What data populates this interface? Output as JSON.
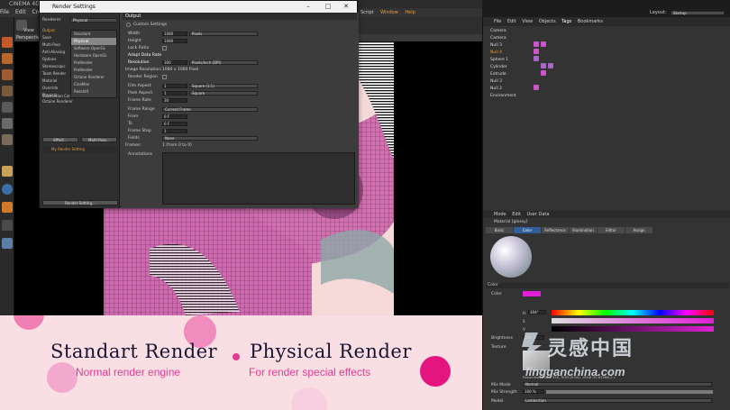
{
  "app": {
    "title": "CINEMA 4D R19",
    "menu": [
      "File",
      "Edit",
      "Create"
    ],
    "menu_right": [
      "MoGraph",
      "Character",
      "Pipeline",
      "Plugins",
      "Octane",
      "Script",
      "Window",
      "Help"
    ],
    "layout_label": "Layout:",
    "layout_value": "Startup",
    "viewport_label": "Perspective",
    "toolbar_label": "View"
  },
  "dialog": {
    "title": "Render Settings",
    "renderer_label": "Renderer",
    "renderer_value": "Physical",
    "renderer_options": [
      "Standard",
      "Physical",
      "Software OpenGL",
      "Hardware OpenGL",
      "ProRender",
      "ProRender",
      "Octane Renderer",
      "CineMan",
      "Redshift"
    ],
    "left_items": [
      "Output",
      "Save",
      "Multi-Pass",
      "Anti-Aliasing",
      "Options",
      "Stereoscopic",
      "Team Render",
      "Material Override",
      "Physical",
      "Submission Center",
      "Octane Renderer"
    ],
    "effect_button": "Effect...",
    "multipass_button": "Multi-Pass...",
    "my_setting": "My Render Setting",
    "render_setting_button": "Render Setting...",
    "section_title": "Output",
    "custom_settings": "Custom Settings",
    "fields": [
      {
        "label": "Width",
        "value": "1080",
        "unit": "Pixels"
      },
      {
        "label": "Height",
        "value": "1080",
        "unit": ""
      },
      {
        "label": "Lock Ratio",
        "value": "",
        "unit": ""
      },
      {
        "label": "Adapt Data Rate",
        "value": "",
        "unit": ""
      },
      {
        "label": "Resolution",
        "value": "300",
        "unit": "Pixels/Inch (DPI)"
      },
      {
        "label": "Image Resolution:",
        "value": "1080 x 1080 Pixel",
        "unit": ""
      },
      {
        "label": "Render Region",
        "value": "",
        "unit": ""
      },
      {
        "label": "Film Aspect",
        "value": "1",
        "unit": "Square (1:1)"
      },
      {
        "label": "Pixel Aspect",
        "value": "1",
        "unit": "Square"
      },
      {
        "label": "Frame Rate",
        "value": "30",
        "unit": ""
      },
      {
        "label": "Frame Range",
        "value": "",
        "unit": "Current Frame"
      },
      {
        "label": "From",
        "value": "0 F",
        "unit": ""
      },
      {
        "label": "To",
        "value": "0 F",
        "unit": ""
      },
      {
        "label": "Frame Step",
        "value": "1",
        "unit": ""
      },
      {
        "label": "Fields",
        "value": "",
        "unit": "None"
      },
      {
        "label": "Frames:",
        "value": "1 (from 0 to 0)",
        "unit": ""
      },
      {
        "label": "Annotations",
        "value": "",
        "unit": ""
      }
    ]
  },
  "objects": {
    "menu": [
      "File",
      "Edit",
      "View",
      "Objects",
      "Tags",
      "Bookmarks"
    ],
    "rows": [
      "Camera",
      "Camera",
      "Null 3",
      "Null 4",
      "Sphere 1",
      "Cylinder",
      "Extrude",
      "Null 3",
      "Null 2",
      "Environment"
    ]
  },
  "attributes": {
    "menu": [
      "Mode",
      "Edit",
      "User Data"
    ],
    "material_name": "Material [glossy]",
    "tabs": [
      "Basic",
      "Color",
      "Reflectance",
      "Illumination",
      "Editor",
      "Assign"
    ],
    "section": "Color",
    "color_label": "Color",
    "h_label": "H",
    "h_value": "304°",
    "s_label": "S",
    "v_label": "V",
    "brightness_label": "Brightness",
    "brightness_value": "100 %",
    "texture_label": "Texture",
    "resolution_text": "Resolution 300 x 450, RGB (8 Bit), sRGB IEC61966-2.1",
    "mix_mode_label": "Mix Mode",
    "mix_mode_value": "Normal",
    "mix_strength_label": "Mix Strength",
    "mix_strength_value": "100 %",
    "model_label": "Model",
    "model_value": "Lambertian"
  },
  "banner": {
    "left_title": "Standart Render",
    "right_title": "Physical Render",
    "left_subtitle": "Normal render engine",
    "right_subtitle": "For render special effects",
    "accent": "#e23b92",
    "dark": "#1a1330"
  },
  "watermark": {
    "cn": "灵感中国",
    "url": "lingganchina.com"
  }
}
